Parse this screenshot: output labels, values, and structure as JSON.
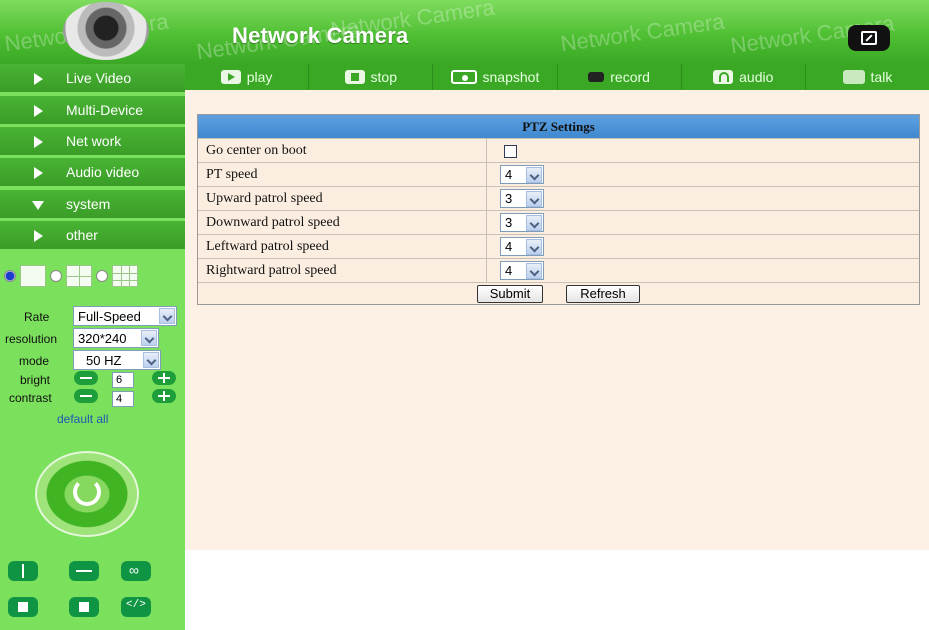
{
  "header": {
    "brand": "Network Camera",
    "watermark": "Network Camera"
  },
  "toolbar": {
    "items": [
      {
        "label": "play",
        "icon": "play-icon"
      },
      {
        "label": "stop",
        "icon": "stop-icon"
      },
      {
        "label": "snapshot",
        "icon": "snapshot-icon"
      },
      {
        "label": "record",
        "icon": "record-icon"
      },
      {
        "label": "audio",
        "icon": "audio-icon"
      },
      {
        "label": "talk",
        "icon": "talk-icon"
      }
    ]
  },
  "sidebar": {
    "menu": [
      "Live Video",
      "Multi-Device",
      "Net work",
      "Audio video",
      "system",
      "other"
    ],
    "controls": {
      "rate_label": "Rate",
      "rate_value": "Full-Speed",
      "resolution_label": "resolution",
      "resolution_value": "320*240",
      "mode_label": "mode",
      "mode_value": "50 HZ",
      "bright_label": "bright",
      "bright_value": "6",
      "contrast_label": "contrast",
      "contrast_value": "4",
      "default_all": "default all"
    }
  },
  "ptz": {
    "title": "PTZ Settings",
    "rows": [
      {
        "label": "Go center on boot",
        "type": "checkbox",
        "checked": false
      },
      {
        "label": "PT speed",
        "type": "select",
        "value": "4"
      },
      {
        "label": "Upward patrol speed",
        "type": "select",
        "value": "3"
      },
      {
        "label": "Downward patrol speed",
        "type": "select",
        "value": "3"
      },
      {
        "label": "Leftward patrol speed",
        "type": "select",
        "value": "4"
      },
      {
        "label": "Rightward patrol speed",
        "type": "select",
        "value": "4"
      }
    ],
    "submit": "Submit",
    "refresh": "Refresh"
  },
  "colors": {
    "header_green": "#4fbf33",
    "toolbar_green": "#3aa825",
    "sidebar_green": "#7be05c",
    "content_bg": "#fdf1e6",
    "table_header_blue": "#3f88cf"
  }
}
